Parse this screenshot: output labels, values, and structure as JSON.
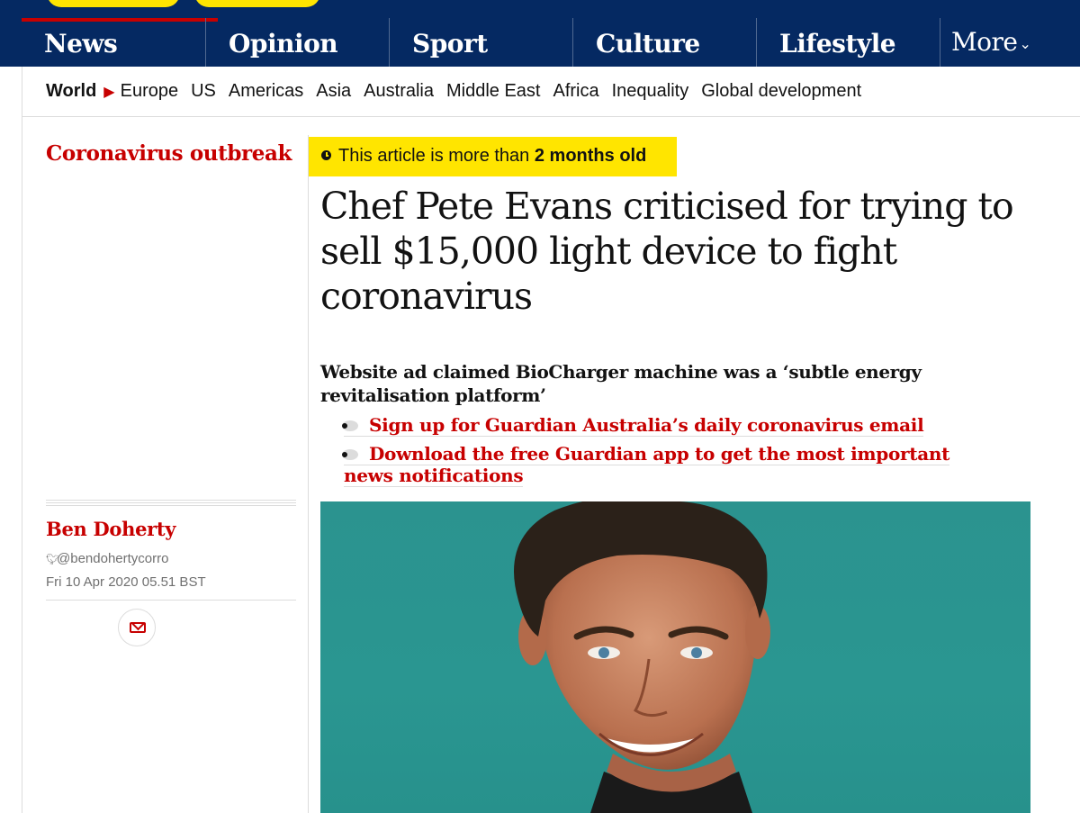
{
  "nav": {
    "pillars": [
      {
        "label": "News"
      },
      {
        "label": "Opinion"
      },
      {
        "label": "Sport"
      },
      {
        "label": "Culture"
      },
      {
        "label": "Lifestyle"
      }
    ],
    "more_label": "More",
    "active_color": "#c70000",
    "brand_color": "#052962",
    "highlight_color": "#ffe500"
  },
  "subnav": {
    "current": "World",
    "items": [
      "Europe",
      "US",
      "Americas",
      "Asia",
      "Australia",
      "Middle East",
      "Africa",
      "Inequality",
      "Global development"
    ]
  },
  "article": {
    "section": "Coronavirus outbreak",
    "age_prefix": "This article is more than",
    "age_value": "2 months old",
    "headline": "Chef Pete Evans criticised for trying to sell $15,000 light device to fight coronavirus",
    "standfirst": "Website ad claimed BioCharger machine was a ‘subtle energy revitalisation platform’",
    "links": [
      "Sign up for Guardian Australia’s daily coronavirus email",
      "Download the free Guardian app to get the most important news notifications"
    ],
    "author": "Ben Doherty",
    "twitter": "@bendohertycorro",
    "date": "Fri 10 Apr 2020 05.51 BST"
  }
}
